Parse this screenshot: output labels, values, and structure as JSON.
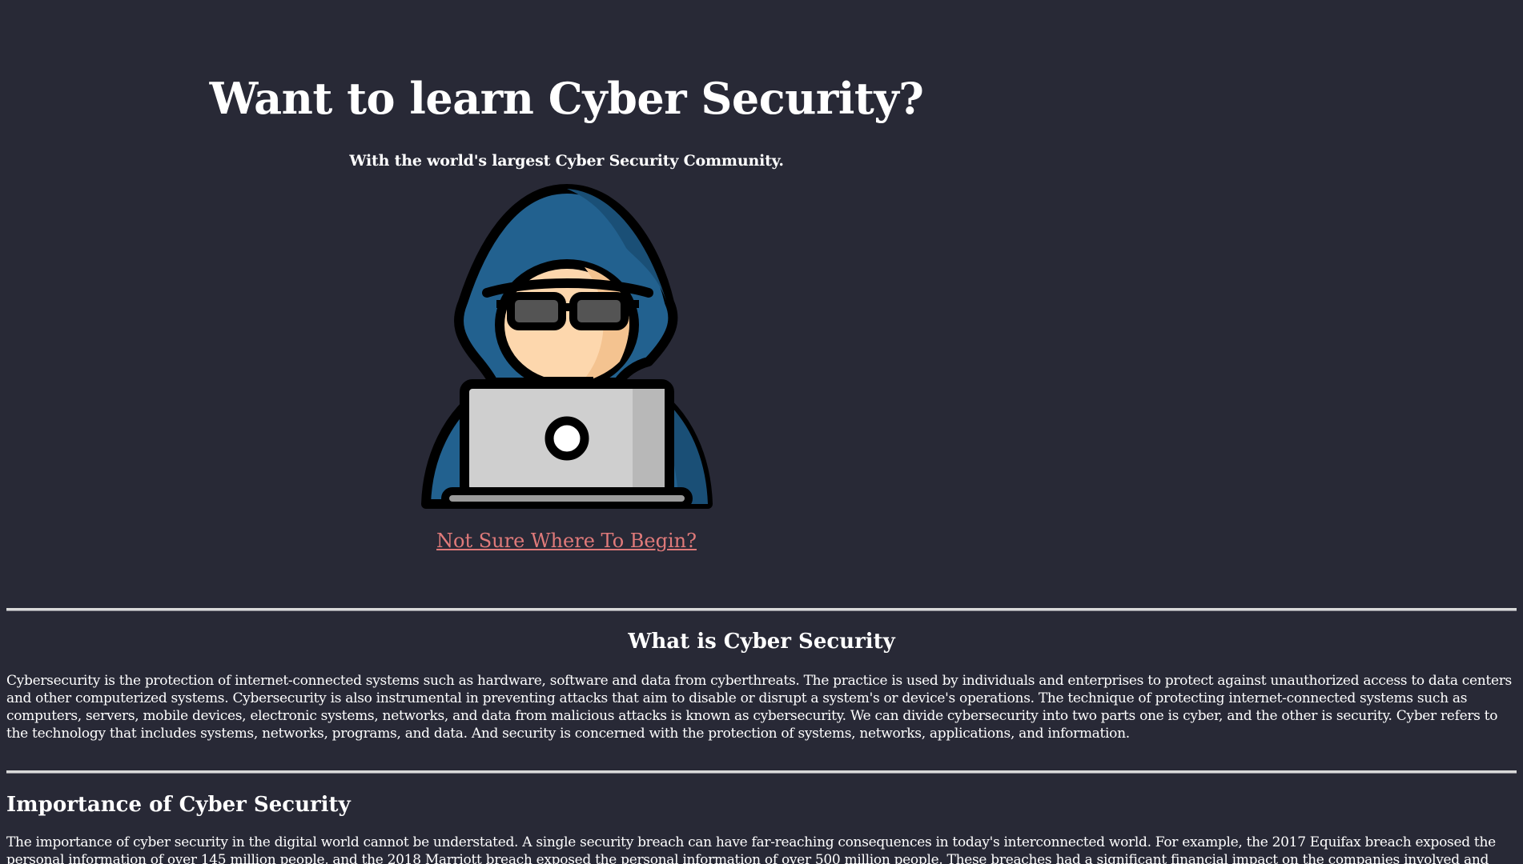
{
  "hero": {
    "title": "Want to learn Cyber Security?",
    "subtitle": "With the world's largest Cyber Security Community.",
    "illustration_icon": "hooded-hacker-with-laptop-icon",
    "cta_link": "Not Sure Where To Begin?"
  },
  "sections": [
    {
      "heading": "What is Cyber Security",
      "body": "Cybersecurity is the protection of internet-connected systems such as hardware, software and data from cyberthreats. The practice is used by individuals and enterprises to protect against unauthorized access to data centers and other computerized systems. Cybersecurity is also instrumental in preventing attacks that aim to disable or disrupt a system's or device's operations. The technique of protecting internet-connected systems such as computers, servers, mobile devices, electronic systems, networks, and data from malicious attacks is known as cybersecurity. We can divide cybersecurity into two parts one is cyber, and the other is security. Cyber refers to the technology that includes systems, networks, programs, and data. And security is concerned with the protection of systems, networks, applications, and information."
    },
    {
      "heading": "Importance of Cyber Security",
      "body": "The importance of cyber security in the digital world cannot be understated. A single security breach can have far-reaching consequences in today's interconnected world. For example, the 2017 Equifax breach exposed the personal information of over 145 million people, and the 2018 Marriott breach exposed the personal information of over 500 million people. These breaches had a significant financial impact on the companies involved and also"
    }
  ],
  "colors": {
    "background": "#282936",
    "text": "#ffffff",
    "link": "#e07a7a",
    "divider": "#d9d9d9",
    "hood": "#22618f",
    "hood_shadow": "#1a4f76",
    "skin": "#fdd7ad",
    "laptop": "#cfcfcf"
  }
}
